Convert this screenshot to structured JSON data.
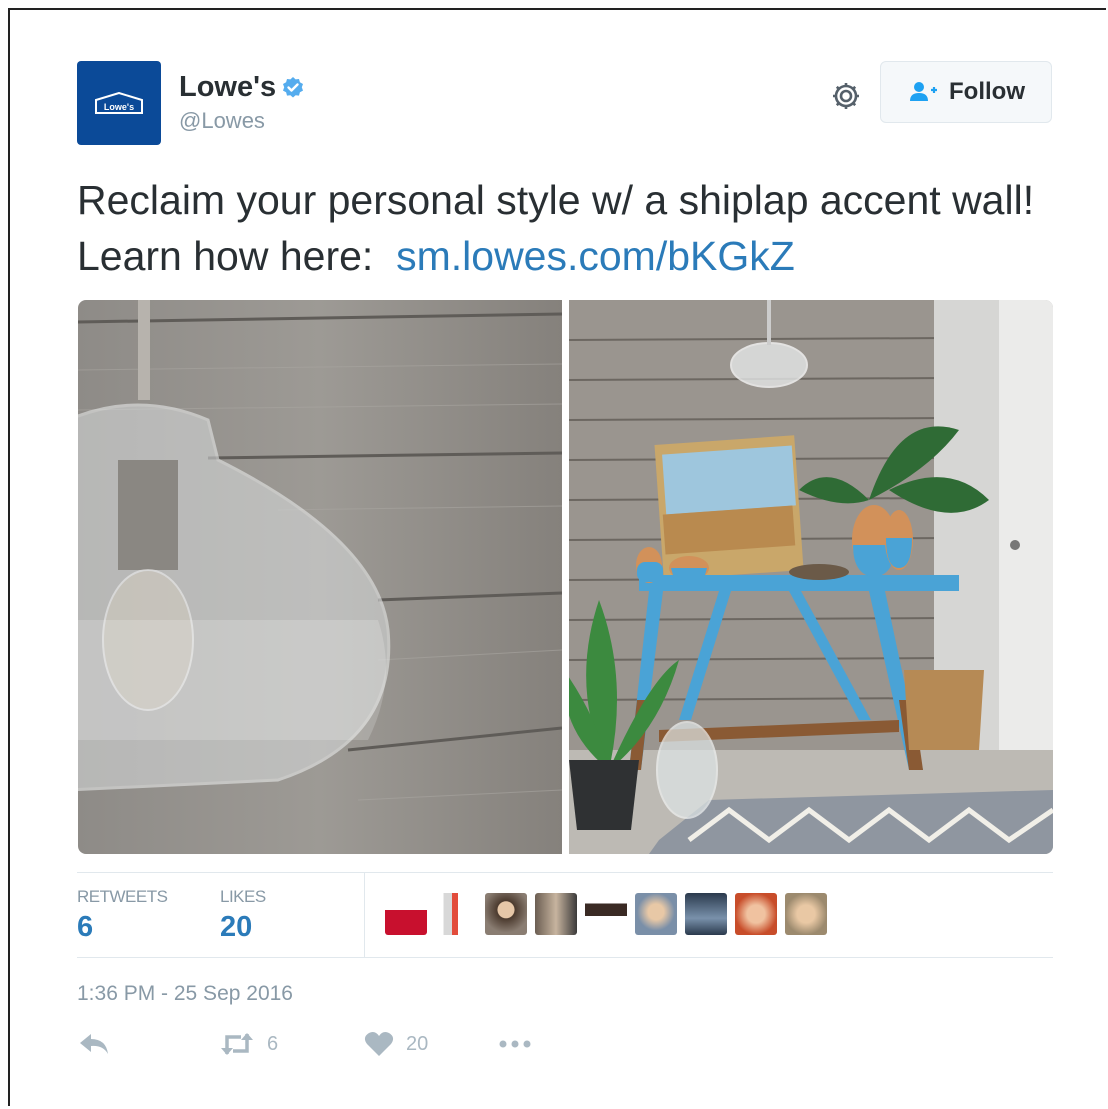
{
  "account": {
    "display_name": "Lowe's",
    "handle": "@Lowes",
    "avatar_text": "Lowe's",
    "brand_color": "#0b4a98",
    "verified": true
  },
  "follow_button": {
    "label": "Follow",
    "icon": "add-user-icon"
  },
  "settings_icon": "gear-icon",
  "tweet": {
    "text": "Reclaim your personal style w/ a shiplap accent wall! Learn how here:",
    "link": "sm.lowes.com/bKGkZ",
    "link_color": "#2b7bb9"
  },
  "media": [
    {
      "description": "Glass pendant lamp against gray shiplap wall"
    },
    {
      "description": "Blue console table with vases and painting against gray shiplap wall"
    }
  ],
  "stats": {
    "retweets_label": "RETWEETS",
    "retweets_value": "6",
    "likes_label": "LIKES",
    "likes_value": "20"
  },
  "likers_count_shown": 9,
  "timestamp": "1:36 PM - 25 Sep 2016",
  "actions": {
    "reply_icon": "reply-icon",
    "retweet_icon": "retweet-icon",
    "retweet_count": "6",
    "like_icon": "heart-icon",
    "like_count": "20",
    "more_icon": "more-icon"
  }
}
